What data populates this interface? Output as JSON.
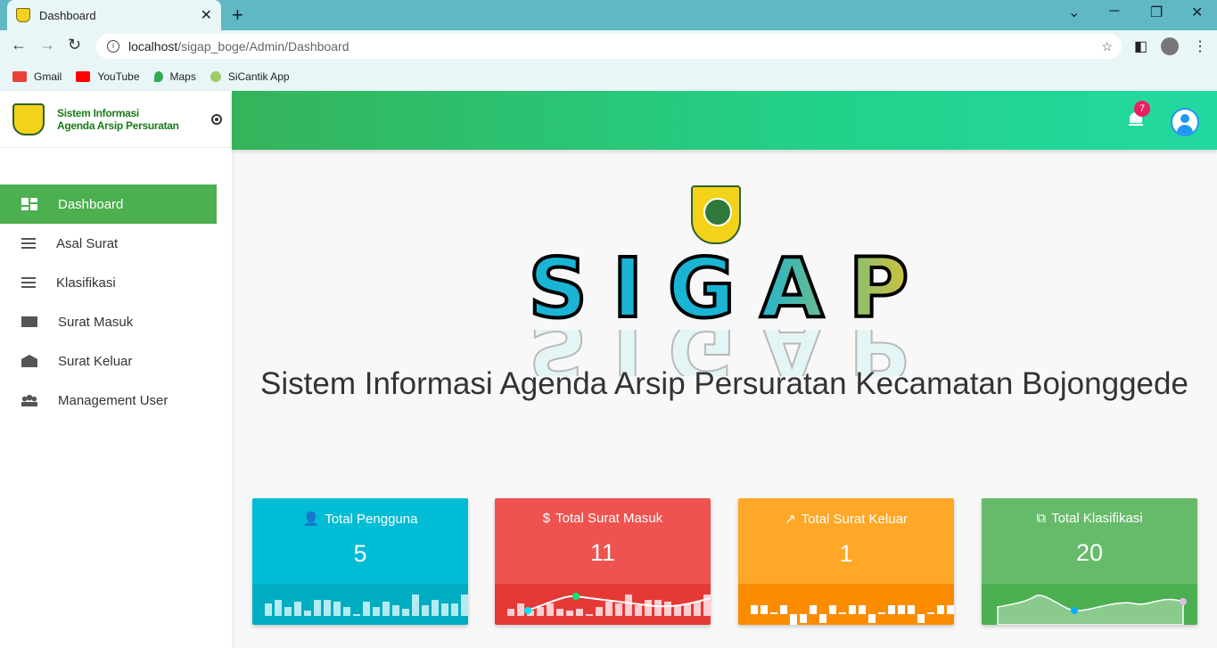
{
  "browser": {
    "tab_title": "Dashboard",
    "url_host": "localhost",
    "url_path": "/sigap_boge/Admin/Dashboard",
    "bookmarks": [
      "Gmail",
      "YouTube",
      "Maps",
      "SiCantik App"
    ]
  },
  "brand": {
    "line1": "Sistem Informasi",
    "line2": "Agenda Arsip Persuratan"
  },
  "sidebar": {
    "items": [
      {
        "label": "Dashboard",
        "icon": "dashboard-icon",
        "active": true
      },
      {
        "label": "Asal Surat",
        "icon": "list-icon",
        "active": false
      },
      {
        "label": "Klasifikasi",
        "icon": "list-icon",
        "active": false
      },
      {
        "label": "Surat Masuk",
        "icon": "mail-icon",
        "active": false
      },
      {
        "label": "Surat Keluar",
        "icon": "drafts-icon",
        "active": false
      },
      {
        "label": "Management User",
        "icon": "group-icon",
        "active": false
      }
    ]
  },
  "topbar": {
    "notification_count": "7"
  },
  "hero": {
    "logo_text": "SIGAP",
    "title": "Sistem Informasi Agenda Arsip Persuratan Kecamatan Bojonggede"
  },
  "cards": [
    {
      "label": "Total Pengguna",
      "value": "5",
      "icon": "person-icon",
      "color": "#00bcd4"
    },
    {
      "label": "Total Surat Masuk",
      "value": "11",
      "icon": "dollar-icon",
      "color": "#ef5350"
    },
    {
      "label": "Total Surat Keluar",
      "value": "1",
      "icon": "trending-up-icon",
      "color": "#ffa726"
    },
    {
      "label": "Total Klasifikasi",
      "value": "20",
      "icon": "copy-icon",
      "color": "#66bb6a"
    }
  ]
}
